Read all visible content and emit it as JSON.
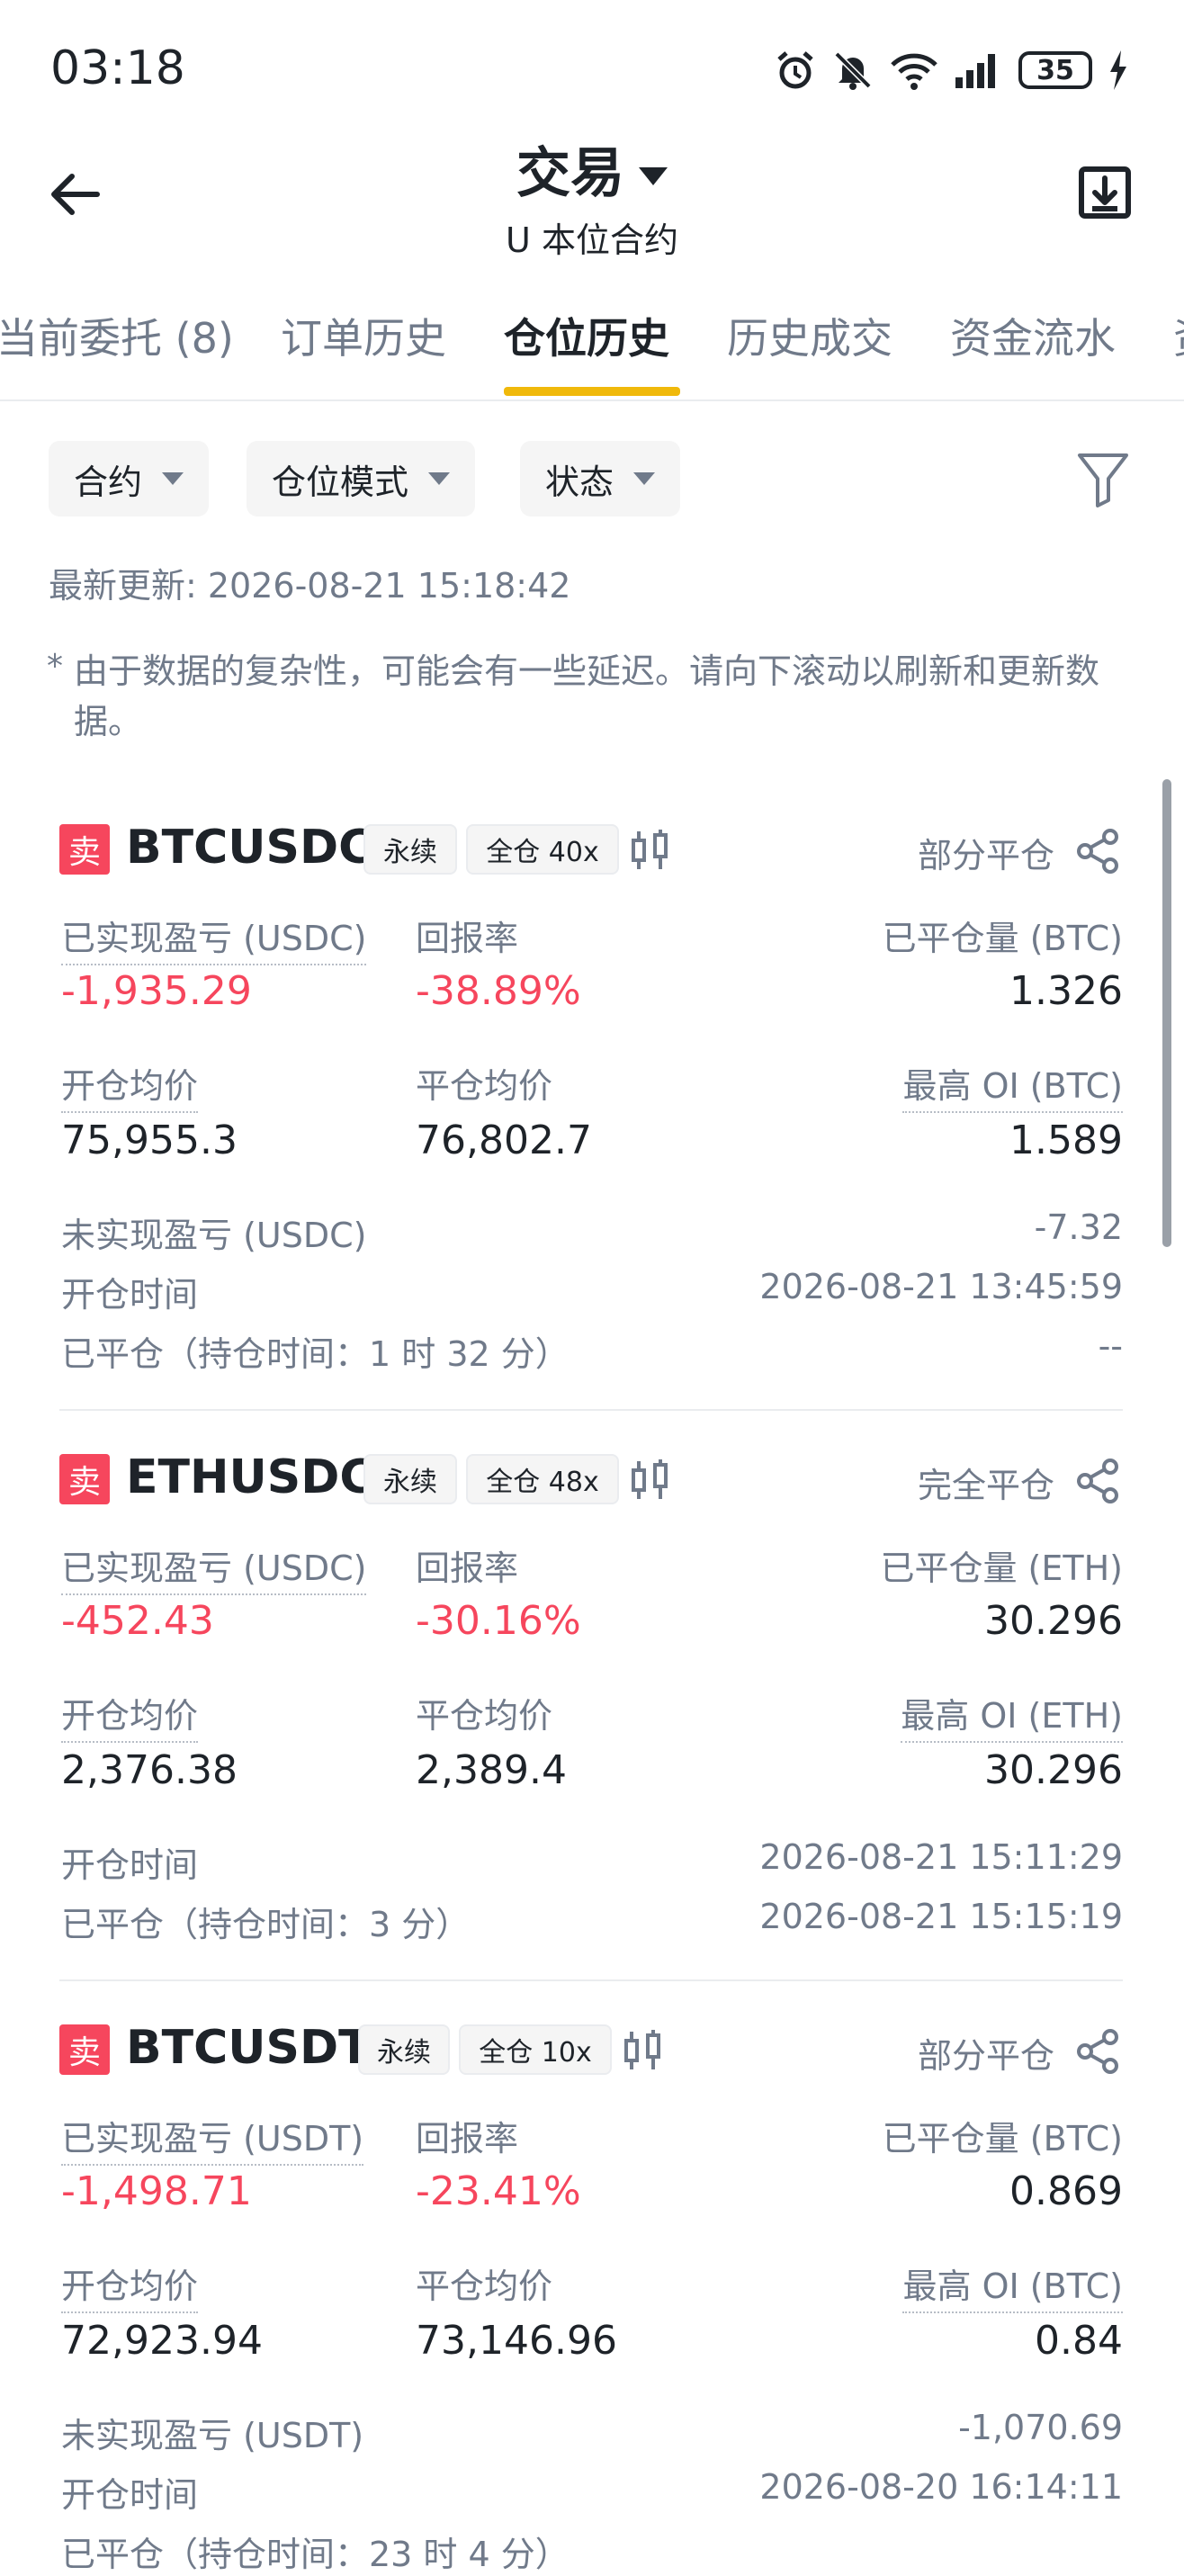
{
  "status_bar": {
    "time": "03:18",
    "battery": "35",
    "icons": [
      "alarm-icon",
      "mute-icon",
      "wifi-icon",
      "signal-icon",
      "battery-icon",
      "charging-icon"
    ]
  },
  "header": {
    "title": "交易",
    "subtitle": "U 本位合约",
    "icons": [
      "back-arrow-icon",
      "download-icon"
    ]
  },
  "tabs": [
    {
      "label": "当前委托 (8)"
    },
    {
      "label": "订单历史"
    },
    {
      "label": "仓位历史",
      "active": true
    },
    {
      "label": "历史成交"
    },
    {
      "label": "资金流水"
    },
    {
      "label": "资"
    }
  ],
  "filters": {
    "contract": "合约",
    "mode": "仓位模式",
    "status": "状态"
  },
  "updated": "最新更新: 2026-08-21 15:18:42",
  "notice_star": "*",
  "notice": "由于数据的复杂性，可能会有一些延迟。请向下滚动以刷新和更新数据。",
  "labels": {
    "sell": "卖",
    "perpetual": "永续",
    "realized_pnl": "已实现盈亏",
    "roi": "回报率",
    "closed_qty": "已平仓量",
    "entry_price": "开仓均价",
    "close_price": "平仓均价",
    "max_oi": "最高 OI",
    "unrealized_pnl": "未实现盈亏",
    "open_time": "开仓时间"
  },
  "positions": [
    {
      "symbol": "BTCUSDC",
      "margin": "全仓 40x",
      "status": "部分平仓",
      "realized_pnl_label": "已实现盈亏 (USDC)",
      "roi_label": "回报率",
      "closed_qty_label": "已平仓量 (BTC)",
      "realized_pnl": "-1,935.29",
      "roi": "-38.89%",
      "closed_qty": "1.326",
      "entry_price_label": "开仓均价",
      "close_price_label": "平仓均价",
      "max_oi_label": "最高 OI (BTC)",
      "entry_price": "75,955.3",
      "close_price": "76,802.7",
      "max_oi": "1.589",
      "unrealized_label": "未实现盈亏 (USDC)",
      "unrealized": "-7.32",
      "open_time_label": "开仓时间",
      "open_time": "2026-08-21 13:45:59",
      "closed_label": "已平仓（持仓时间：1 时 32 分）",
      "closed_time": "--"
    },
    {
      "symbol": "ETHUSDC",
      "margin": "全仓 48x",
      "status": "完全平仓",
      "realized_pnl_label": "已实现盈亏 (USDC)",
      "roi_label": "回报率",
      "closed_qty_label": "已平仓量 (ETH)",
      "realized_pnl": "-452.43",
      "roi": "-30.16%",
      "closed_qty": "30.296",
      "entry_price_label": "开仓均价",
      "close_price_label": "平仓均价",
      "max_oi_label": "最高 OI (ETH)",
      "entry_price": "2,376.38",
      "close_price": "2,389.4",
      "max_oi": "30.296",
      "open_time_label": "开仓时间",
      "open_time": "2026-08-21 15:11:29",
      "closed_label": "已平仓（持仓时间：3 分）",
      "closed_time": "2026-08-21 15:15:19"
    },
    {
      "symbol": "BTCUSDT",
      "margin": "全仓 10x",
      "status": "部分平仓",
      "realized_pnl_label": "已实现盈亏 (USDT)",
      "roi_label": "回报率",
      "closed_qty_label": "已平仓量 (BTC)",
      "realized_pnl": "-1,498.71",
      "roi": "-23.41%",
      "closed_qty": "0.869",
      "entry_price_label": "开仓均价",
      "close_price_label": "平仓均价",
      "max_oi_label": "最高 OI (BTC)",
      "entry_price": "72,923.94",
      "close_price": "73,146.96",
      "max_oi": "0.84",
      "unrealized_label": "未实现盈亏 (USDT)",
      "unrealized": "-1,070.69",
      "open_time_label": "开仓时间",
      "open_time": "2026-08-20 16:14:11",
      "closed_label": "已平仓（持仓时间：23 时 4 分）"
    }
  ]
}
